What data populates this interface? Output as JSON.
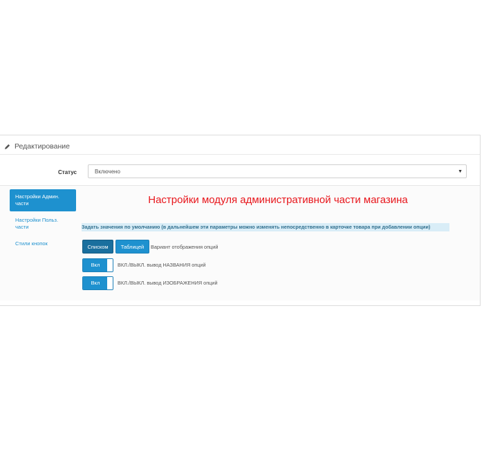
{
  "panel": {
    "title": "Редактирование",
    "title_icon": "pencil-icon"
  },
  "status": {
    "label": "Статус",
    "value": "Включено"
  },
  "nav": {
    "items": [
      {
        "label": "Настройки Админ. части",
        "active": true
      },
      {
        "label": "Настройки Польз. части",
        "active": false
      },
      {
        "label": "Стили кнопок",
        "active": false
      }
    ]
  },
  "main": {
    "heading": "Настройки модуля административной части магазина",
    "default_note": "Задать значения по умолчанию (в дальнейшем эти параметры можно изменять непосредственно в карточке товара при добавлении опции)",
    "display_mode": {
      "options": [
        "Списком",
        "Таблицей"
      ],
      "selected": "Списком",
      "label": "Вариант отображения опций"
    },
    "toggles": [
      {
        "state_label": "Вкл",
        "label": "ВКЛ./ВЫКЛ. вывод НАЗВАНИЯ опций"
      },
      {
        "state_label": "Вкл",
        "label": "ВКЛ./ВЫКЛ. вывод ИЗОБРАЖЕНИЯ опций"
      }
    ]
  },
  "colors": {
    "accent": "#1e91cf",
    "accent_dark": "#1a6f9e",
    "heading": "#e8151b",
    "note_bg": "#d9edf7"
  }
}
